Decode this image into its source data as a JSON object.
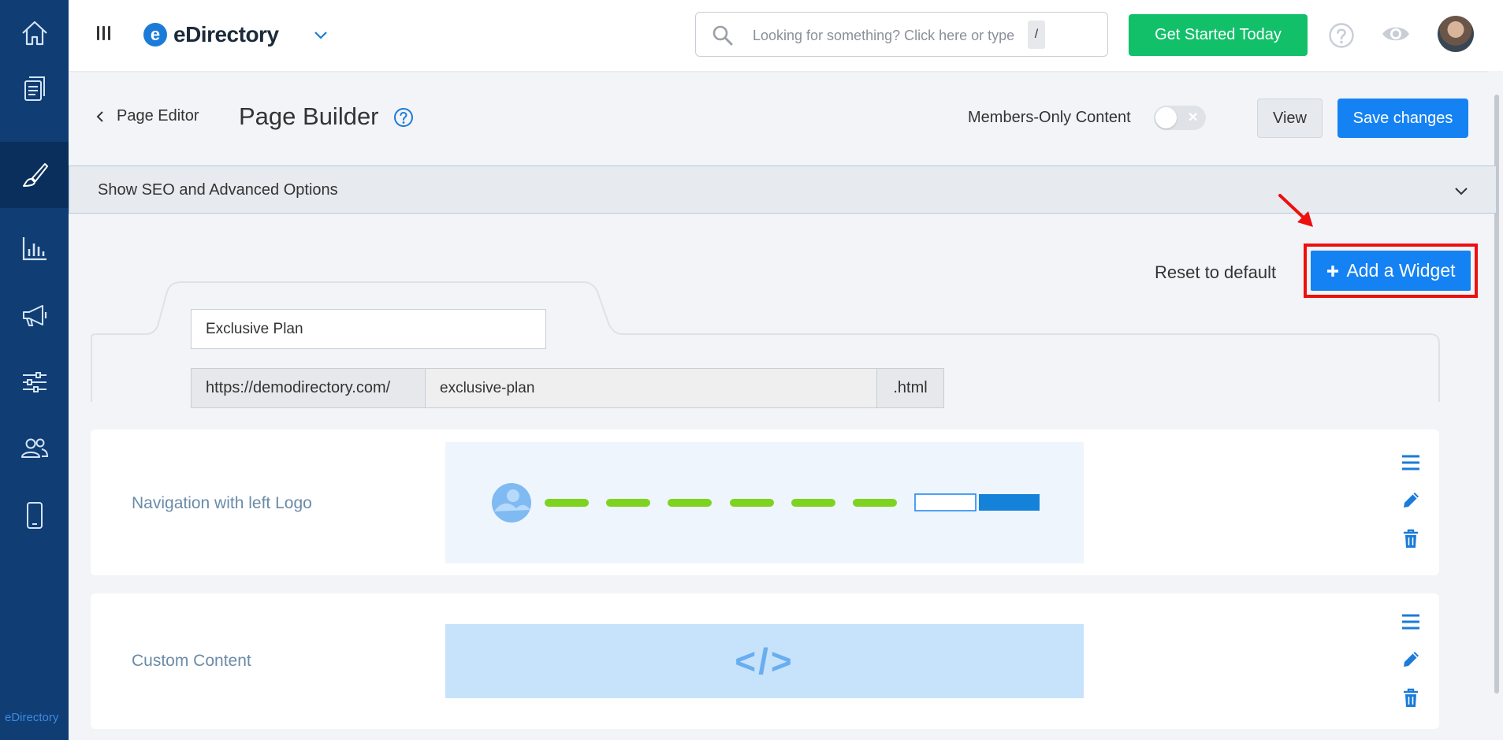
{
  "sidebar": {
    "items": [
      {
        "name": "home-icon",
        "active": false
      },
      {
        "name": "pages-icon",
        "active": false
      },
      {
        "name": "brush-icon",
        "active": true
      },
      {
        "name": "reports-icon",
        "active": false
      },
      {
        "name": "megaphone-icon",
        "active": false
      },
      {
        "name": "settings-sliders-icon",
        "active": false
      },
      {
        "name": "users-icon",
        "active": false
      },
      {
        "name": "mobile-icon",
        "active": false
      }
    ],
    "brand": "eDirectory"
  },
  "topbar": {
    "logo_mark": "e",
    "logo_text": "eDirectory",
    "search_placeholder": "Looking for something? Click here or type",
    "search_shortcut": "/",
    "cta_label": "Get Started Today"
  },
  "header": {
    "back_label": "Page Editor",
    "title": "Page Builder",
    "members_only_label": "Members-Only Content",
    "members_only_enabled": false,
    "view_label": "View",
    "save_label": "Save changes"
  },
  "seo": {
    "label": "Show SEO and Advanced Options"
  },
  "actions": {
    "reset_label": "Reset to default",
    "add_widget_label": "Add a Widget"
  },
  "page": {
    "name": "Exclusive Plan",
    "url_prefix": "https://demodirectory.com/",
    "url_slug": "exclusive-plan",
    "url_suffix": ".html"
  },
  "widgets": [
    {
      "label": "Navigation with left Logo",
      "preview": "navigation-preview"
    },
    {
      "label": "Custom Content",
      "preview": "custom-content-preview",
      "preview_glyph": "</>"
    }
  ],
  "colors": {
    "sidebar": "#0f3d74",
    "primary": "#1582f3",
    "cta_green": "#12c06a",
    "highlight_red": "#ee0f0f",
    "nav_preview_green": "#7ed321"
  }
}
